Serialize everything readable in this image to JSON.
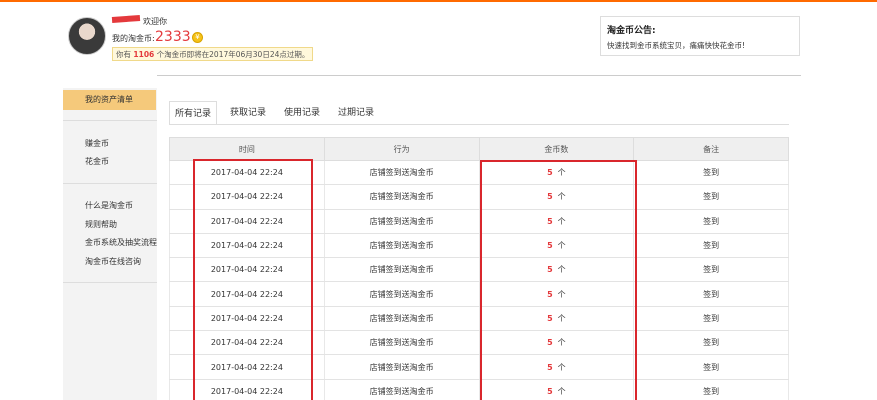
{
  "header": {
    "welcome": "欢迎你",
    "coin_label": "我的淘金币:",
    "coin_value": "2333",
    "coin_icon": "coin-icon",
    "expire_prefix": "你有",
    "expire_amount": "1106",
    "expire_suffix": "个淘金币即将在2017年06月30日24点过期。"
  },
  "notice": {
    "title": "淘金币公告:",
    "text": "快速找到金币系统宝贝，痛痛快快花金币!"
  },
  "sidebar": {
    "active": "我的资产清单",
    "group1": [
      "赚金币",
      "花金币"
    ],
    "group2": [
      "什么是淘金币",
      "规则帮助",
      "金币系统及抽奖流程",
      "淘金币在线咨询"
    ]
  },
  "tabs": [
    "所有记录",
    "获取记录",
    "使用记录",
    "过期记录"
  ],
  "table": {
    "headers": [
      "时间",
      "行为",
      "金币数",
      "备注"
    ],
    "rows": [
      {
        "time": "2017-04-04 22:24",
        "action": "店铺签到送淘金币",
        "amount": "5",
        "unit": "个",
        "note": "签到"
      },
      {
        "time": "2017-04-04 22:24",
        "action": "店铺签到送淘金币",
        "amount": "5",
        "unit": "个",
        "note": "签到"
      },
      {
        "time": "2017-04-04 22:24",
        "action": "店铺签到送淘金币",
        "amount": "5",
        "unit": "个",
        "note": "签到"
      },
      {
        "time": "2017-04-04 22:24",
        "action": "店铺签到送淘金币",
        "amount": "5",
        "unit": "个",
        "note": "签到"
      },
      {
        "time": "2017-04-04 22:24",
        "action": "店铺签到送淘金币",
        "amount": "5",
        "unit": "个",
        "note": "签到"
      },
      {
        "time": "2017-04-04 22:24",
        "action": "店铺签到送淘金币",
        "amount": "5",
        "unit": "个",
        "note": "签到"
      },
      {
        "time": "2017-04-04 22:24",
        "action": "店铺签到送淘金币",
        "amount": "5",
        "unit": "个",
        "note": "签到"
      },
      {
        "time": "2017-04-04 22:24",
        "action": "店铺签到送淘金币",
        "amount": "5",
        "unit": "个",
        "note": "签到"
      },
      {
        "time": "2017-04-04 22:24",
        "action": "店铺签到送淘金币",
        "amount": "5",
        "unit": "个",
        "note": "签到"
      },
      {
        "time": "2017-04-04 22:24",
        "action": "店铺签到送淘金币",
        "amount": "5",
        "unit": "个",
        "note": "签到"
      }
    ]
  },
  "colors": {
    "accent": "#ff6a00",
    "highlight": "#d9262c",
    "sidebar_active": "#f5c97b"
  }
}
